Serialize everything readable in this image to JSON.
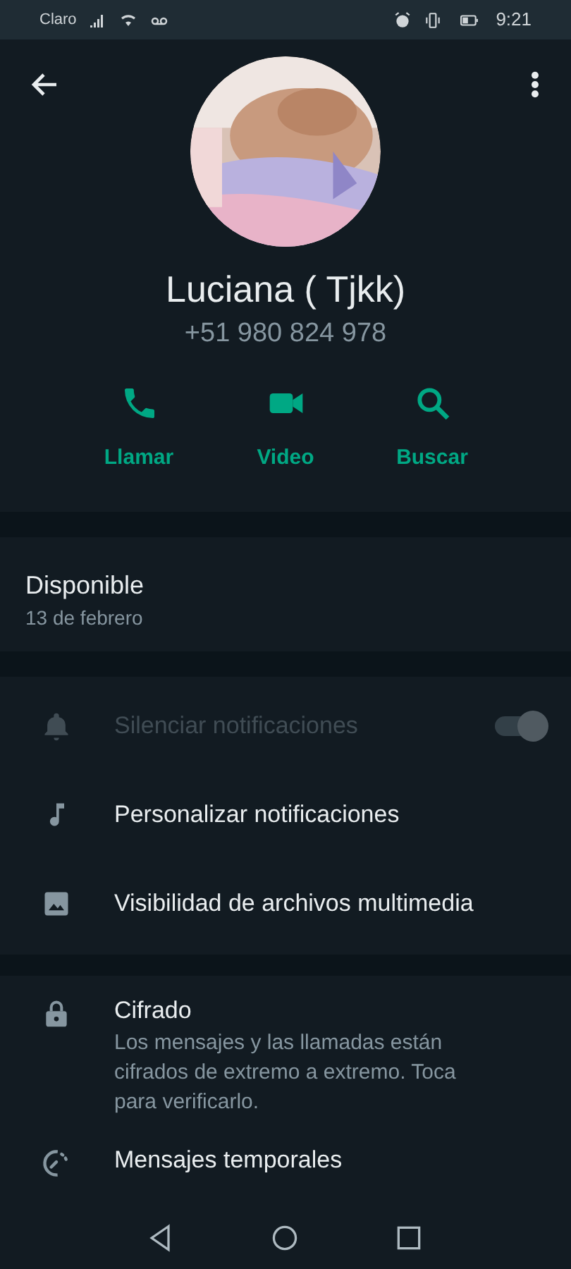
{
  "status_bar": {
    "carrier": "Claro",
    "time": "9:21"
  },
  "profile": {
    "name": "Luciana ( Tjkk)",
    "phone": "+51 980 824 978"
  },
  "actions": [
    {
      "kind": "call",
      "label": "Llamar"
    },
    {
      "kind": "video",
      "label": "Video"
    },
    {
      "kind": "search",
      "label": "Buscar"
    }
  ],
  "about": {
    "status": "Disponible",
    "date": "13 de febrero"
  },
  "settings": [
    {
      "kind": "mute",
      "label": "Silenciar notificaciones",
      "disabled": true,
      "on": true
    },
    {
      "kind": "tone",
      "label": "Personalizar notificaciones",
      "disabled": false
    },
    {
      "kind": "media",
      "label": "Visibilidad de archivos multimedia",
      "disabled": false
    }
  ],
  "privacy": [
    {
      "kind": "encryption",
      "label": "Cifrado",
      "description": "Los mensajes y las llamadas están cifrados de extremo a extremo. Toca para verificarlo."
    },
    {
      "kind": "timer",
      "label": "Mensajes temporales"
    }
  ]
}
